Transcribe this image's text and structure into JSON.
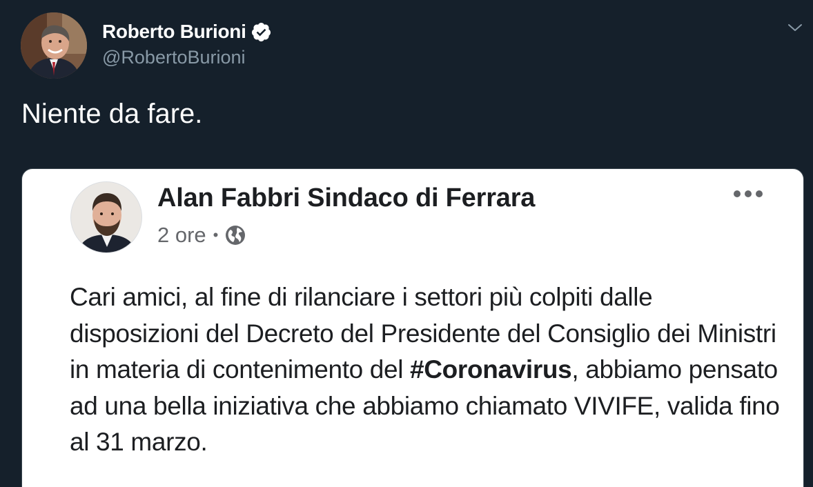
{
  "tweet": {
    "author": {
      "display_name": "Roberto Burioni",
      "handle": "@RobertoBurioni",
      "verified": true
    },
    "text": "Niente da fare.",
    "menu_icon": "chevron-down-icon"
  },
  "embedded_post": {
    "author_name": "Alan Fabbri Sindaco di Ferrara",
    "time": "2 ore",
    "separator": "•",
    "visibility_icon": "globe-icon",
    "more_icon": "more-options-icon",
    "text_before_hashtag": "Cari amici, al fine di rilanciare i settori più colpiti dalle disposizioni del Decreto del Presidente del Consiglio dei Ministri in materia di contenimento del ",
    "hashtag": "#Coronavirus",
    "text_after_hashtag": ", abbiamo pensato ad una bella iniziativa che abbiamo chiamato VIVIFE, valida fino al 31 marzo."
  },
  "colors": {
    "background": "#15202b",
    "name": "#ffffff",
    "handle": "#8899a6",
    "verified_badge": "#ffffff",
    "card_background": "#ffffff",
    "post_text": "#1c1e21",
    "meta_text": "#65676b"
  }
}
